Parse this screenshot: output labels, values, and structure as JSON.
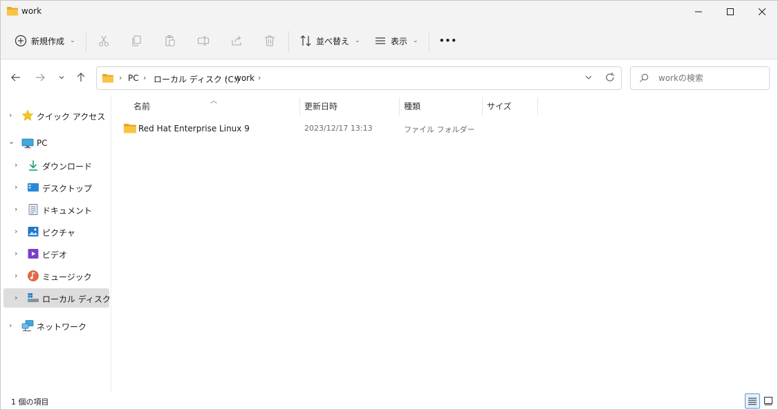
{
  "window": {
    "title": "work"
  },
  "toolbar": {
    "new_label": "新規作成",
    "sort_label": "並べ替え",
    "view_label": "表示",
    "more_label": "•••"
  },
  "address": {
    "breadcrumbs": [
      "PC",
      "ローカル ディスク (C:)",
      "work"
    ]
  },
  "search": {
    "placeholder": "workの検索"
  },
  "sidebar": {
    "items": [
      {
        "label": "クイック アクセス",
        "icon": "star-icon"
      },
      {
        "label": "PC",
        "icon": "pc-icon"
      },
      {
        "label": "ダウンロード",
        "icon": "download-icon"
      },
      {
        "label": "デスクトップ",
        "icon": "desktop-icon"
      },
      {
        "label": "ドキュメント",
        "icon": "document-icon"
      },
      {
        "label": "ピクチャ",
        "icon": "pictures-icon"
      },
      {
        "label": "ビデオ",
        "icon": "videos-icon"
      },
      {
        "label": "ミュージック",
        "icon": "music-icon"
      },
      {
        "label": "ローカル ディスク (C:)",
        "icon": "drive-icon"
      },
      {
        "label": "ネットワーク",
        "icon": "network-icon"
      }
    ],
    "selected": "ローカル ディスク (C:)"
  },
  "columns": [
    "名前",
    "更新日時",
    "種類",
    "サイズ"
  ],
  "files": [
    {
      "name": "Red Hat Enterprise Linux 9",
      "modified": "2023/12/17 13:13",
      "type": "ファイル フォルダー",
      "size": "",
      "icon": "folder-icon"
    }
  ],
  "status": {
    "item_count": "1 個の項目"
  },
  "colors": {
    "folder": "#f8c543",
    "accent": "#0067c0",
    "selected_bg": "#dddddd"
  }
}
